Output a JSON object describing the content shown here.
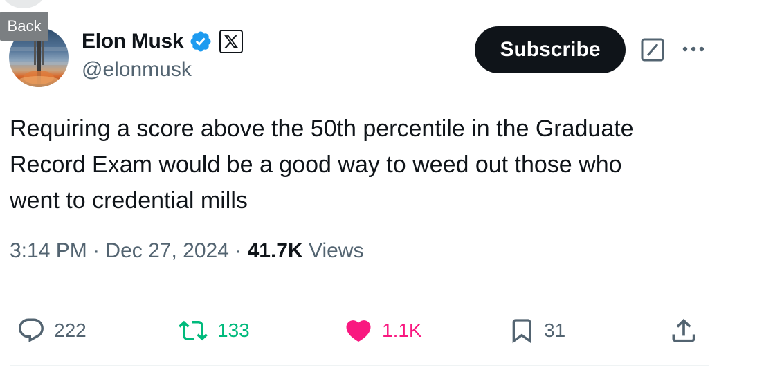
{
  "nav": {
    "back_label": "Back"
  },
  "author": {
    "name": "Elon Musk",
    "handle": "@elonmusk",
    "verified": true,
    "verified_color": "#1d9bf0"
  },
  "header": {
    "subscribe_label": "Subscribe"
  },
  "tweet": {
    "text": "Requiring a score above the 50th percentile in the Graduate\nRecord Exam would be a good way to weed out those who\nwent to credential mills",
    "time": "3:14 PM",
    "date": "Dec 27, 2024",
    "separator": "·",
    "views_count": "41.7K",
    "views_label": "Views"
  },
  "actions": {
    "replies": "222",
    "reposts": "133",
    "likes": "1.1K",
    "bookmarks": "31"
  },
  "colors": {
    "text_primary": "#0f1419",
    "text_secondary": "#536471",
    "repost_green": "#00ba7c",
    "like_pink": "#f91880",
    "verified_blue": "#1d9bf0"
  },
  "icons": [
    "chat-bubble-icon",
    "repost-icon",
    "heart-icon",
    "bookmark-icon",
    "share-icon",
    "grok-icon",
    "more-icon",
    "verified-badge-icon",
    "x-logo-icon"
  ]
}
